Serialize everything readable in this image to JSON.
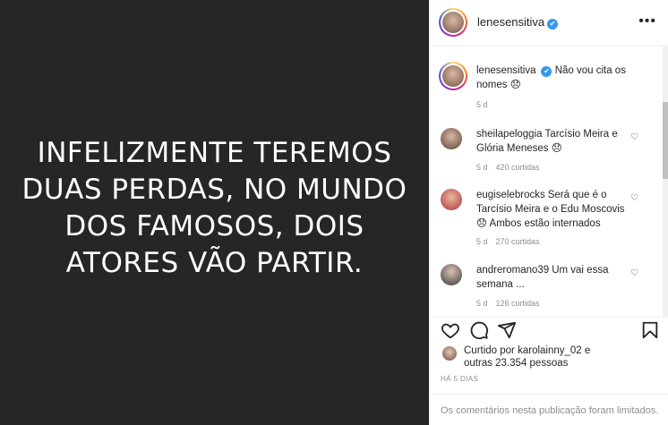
{
  "media": {
    "lines": [
      "INFELIZMENTE TEREMOS",
      "DUAS PERDAS, NO MUNDO",
      "DOS FAMOSOS, DOIS",
      "ATORES VÃO PARTIR."
    ]
  },
  "header": {
    "username": "lenesensitiva",
    "verified_glyph": "✔",
    "more_glyph": "•••"
  },
  "caption": {
    "username": "lenesensitiva",
    "text": "Não vou cita os nomes 😞",
    "time": "5 d"
  },
  "comments": [
    {
      "username": "sheilapeloggia",
      "text": "Tarcísio Meira e Glória Meneses 😞",
      "time": "5 d",
      "likes": "420 curtidas"
    },
    {
      "username": "eugiselebrocks",
      "text": "Será que é o Tarcísio Meira e o Edu Moscovis 😞 Ambos estão internados",
      "time": "5 d",
      "likes": "270 curtidas"
    },
    {
      "username": "andreromano39",
      "text": "Um vai essa semana ...",
      "time": "5 d",
      "likes": "126 curtidas"
    }
  ],
  "likes": {
    "prefix": "Curtido por ",
    "user": "karolainny_02",
    "middle": " e",
    "others": "outras 23.354 pessoas"
  },
  "ago": "HÁ 5 DIAS",
  "footer": {
    "message": "Os comentários nesta publicação foram limitados."
  },
  "icons": {
    "like": "heart-icon",
    "comment": "comment-icon",
    "share": "share-icon",
    "save": "bookmark-icon",
    "comment_like": "heart-icon"
  },
  "colors": {
    "media_bg": "#262626",
    "verified": "#3897f0",
    "muted": "#8e8e8e"
  }
}
